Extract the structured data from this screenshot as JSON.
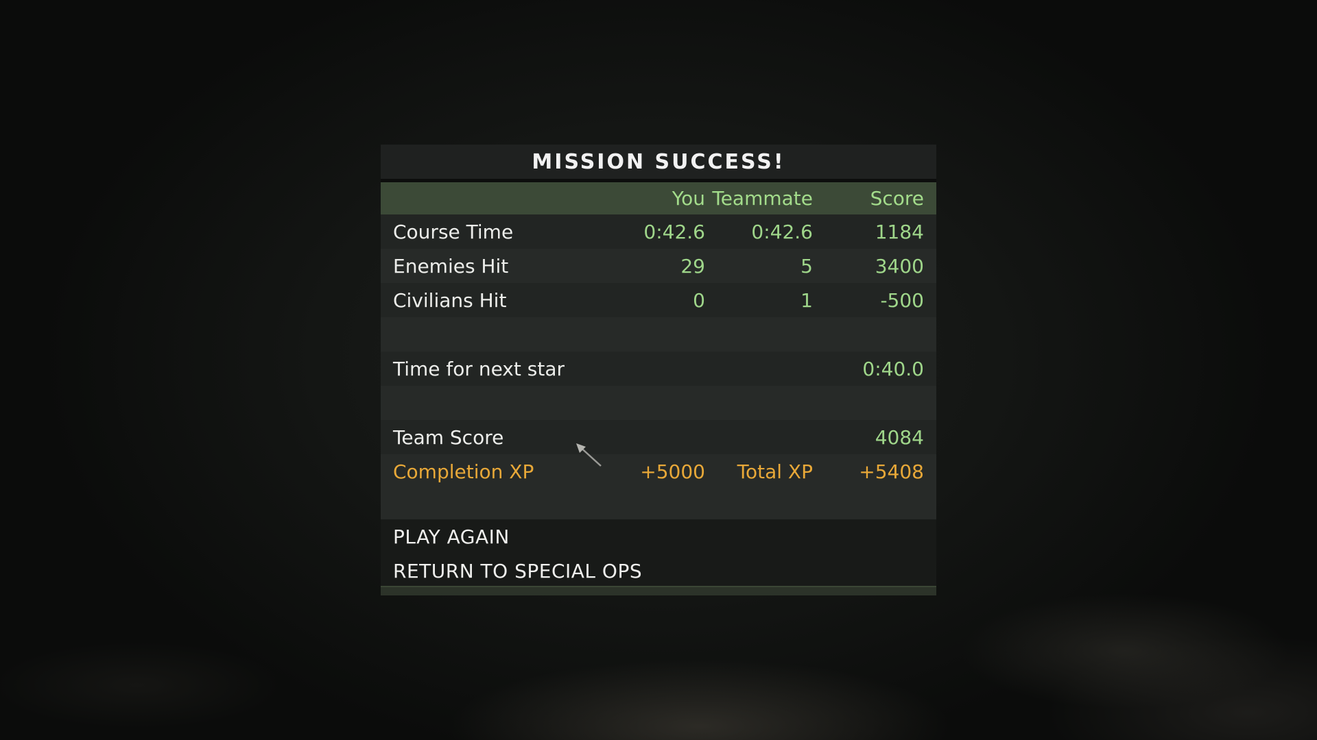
{
  "dialog": {
    "title": "MISSION SUCCESS!",
    "columns": {
      "you": "You",
      "teammate": "Teammate",
      "score": "Score"
    },
    "stats": [
      {
        "label": "Course Time",
        "you": "0:42.6",
        "teammate": "0:42.6",
        "score": "1184"
      },
      {
        "label": "Enemies Hit",
        "you": "29",
        "teammate": "5",
        "score": "3400"
      },
      {
        "label": "Civilians Hit",
        "you": "0",
        "teammate": "1",
        "score": "-500"
      }
    ],
    "next_star": {
      "label": "Time for next star",
      "value": "0:40.0"
    },
    "team_score": {
      "label": "Team Score",
      "value": "4084"
    },
    "xp": {
      "completion_label": "Completion XP",
      "completion_value": "+5000",
      "total_label": "Total XP",
      "total_value": "+5408"
    },
    "menu": {
      "play_again": "PLAY AGAIN",
      "return": "RETURN TO SPECIAL OPS"
    }
  },
  "colors": {
    "stat_value": "#9fd68a",
    "header_bar": "#3c4a37",
    "xp_text": "#e8a838"
  },
  "icons": {
    "cursor": "pointer-arrow-icon"
  }
}
